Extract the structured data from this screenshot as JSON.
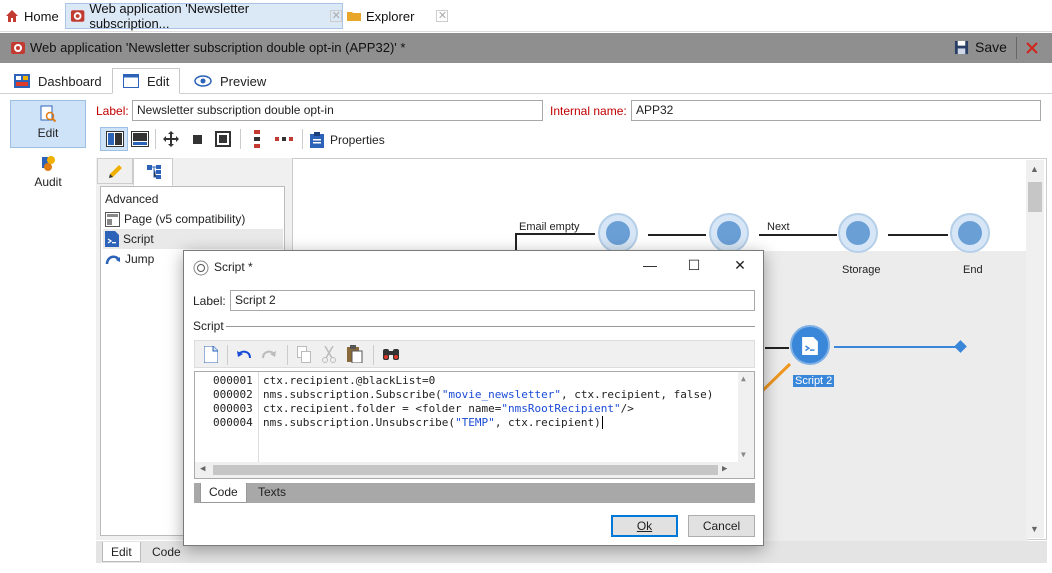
{
  "top_tabs": {
    "home": "Home",
    "webapp": "Web application 'Newsletter subscription...",
    "explorer": "Explorer"
  },
  "document": {
    "title": "Web application 'Newsletter subscription double opt-in (APP32)' *",
    "save_label": "Save"
  },
  "view_tabs": [
    "Dashboard",
    "Edit",
    "Preview"
  ],
  "left_nav": [
    "Edit",
    "Audit"
  ],
  "form": {
    "label_caption": "Label:",
    "label_value": "Newsletter subscription double opt-in",
    "internal_caption": "Internal name:",
    "internal_value": "APP32"
  },
  "toolbar": {
    "properties_label": "Properties"
  },
  "tree": {
    "group": "Advanced",
    "items": [
      "Page (v5 compatibility)",
      "Script",
      "Jump"
    ]
  },
  "workflow": {
    "edge_labels": [
      "Email empty",
      "Next"
    ],
    "node_labels": [
      "Storage",
      "End",
      "Script 2"
    ]
  },
  "bottom_tabs": [
    "Edit",
    "Code"
  ],
  "modal": {
    "title": "Script *",
    "label_caption": "Label:",
    "label_value": "Script 2",
    "section": "Script",
    "line_numbers": [
      "000001",
      "000002",
      "000003",
      "000004"
    ],
    "code": [
      {
        "a": "ctx.recipient.@blackList=0",
        "s": "",
        "b": ""
      },
      {
        "a": "nms.subscription.Subscribe(",
        "s": "\"movie_newsletter\"",
        "b": ", ctx.recipient, false)"
      },
      {
        "a": "ctx.recipient.folder = <folder name=",
        "s": "\"nmsRootRecipient\"",
        "b": "/>"
      },
      {
        "a": "nms.subscription.Unsubscribe(",
        "s": "\"TEMP\"",
        "b": ", ctx.recipient)"
      }
    ],
    "tabs": [
      "Code",
      "Texts"
    ],
    "ok_label": "Ok",
    "cancel_label": "Cancel"
  },
  "colors": {
    "accent": "#0078d7",
    "node": "#6a9fd6",
    "selected_node": "#3a86d8",
    "arrow": "#f0961e",
    "error_red": "#c00000"
  }
}
